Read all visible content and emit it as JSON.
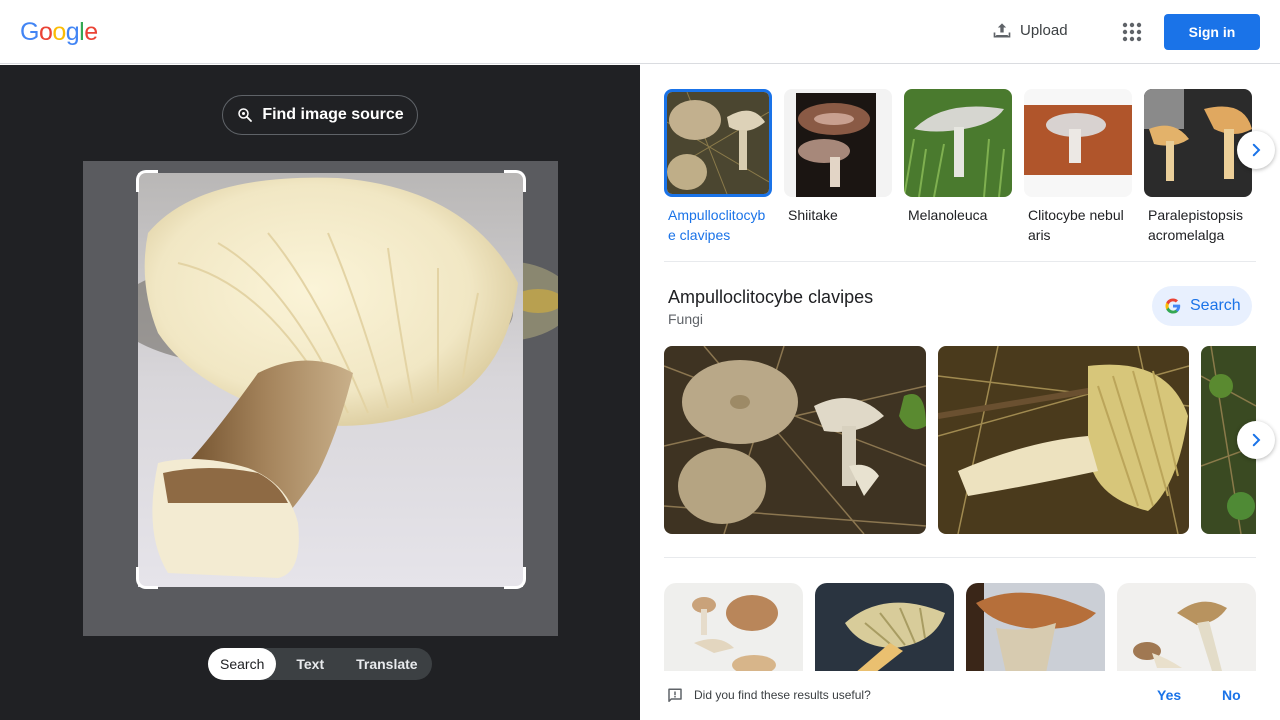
{
  "header": {
    "logo_letters": [
      {
        "ch": "G",
        "color": "#4285f4"
      },
      {
        "ch": "o",
        "color": "#ea4335"
      },
      {
        "ch": "o",
        "color": "#fbbc05"
      },
      {
        "ch": "g",
        "color": "#4285f4"
      },
      {
        "ch": "l",
        "color": "#34a853"
      },
      {
        "ch": "e",
        "color": "#ea4335"
      }
    ],
    "upload_label": "Upload",
    "apps_icon": "apps-grid-icon",
    "signin_label": "Sign in"
  },
  "lens": {
    "find_source_label": "Find image source",
    "modes": [
      "Search",
      "Text",
      "Translate"
    ],
    "active_mode": "Search"
  },
  "related": {
    "items": [
      {
        "label": "Ampulloclitocybe clavipes",
        "selected": true
      },
      {
        "label": "Shiitake",
        "selected": false
      },
      {
        "label": "Melanoleuca",
        "selected": false
      },
      {
        "label": "Clitocybe nebularis",
        "selected": false
      },
      {
        "label": "Paralepistopsis acromelalga",
        "selected": false
      }
    ]
  },
  "entity": {
    "title": "Ampulloclitocybe clavipes",
    "subtitle": "Fungi",
    "search_label": "Search"
  },
  "feedback": {
    "question": "Did you find these results useful?",
    "yes": "Yes",
    "no": "No"
  },
  "colors": {
    "accent": "#1a73e8",
    "dark_panel": "#202124"
  }
}
